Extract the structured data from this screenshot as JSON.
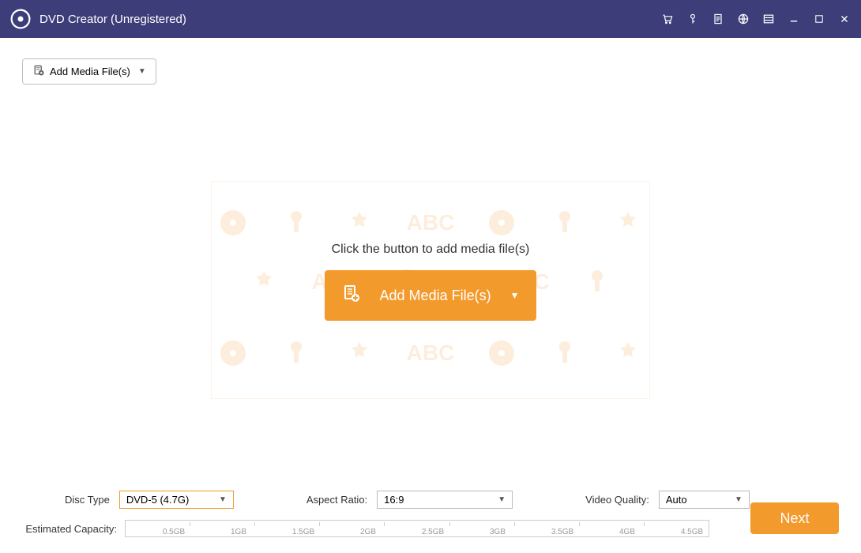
{
  "titlebar": {
    "app_title": "DVD Creator (Unregistered)"
  },
  "toolbar": {
    "add_media_label": "Add Media File(s)"
  },
  "main": {
    "instruction": "Click the button to add media file(s)",
    "add_media_label": "Add Media File(s)"
  },
  "controls": {
    "disc_type_label": "Disc Type",
    "disc_type_value": "DVD-5 (4.7G)",
    "aspect_ratio_label": "Aspect Ratio:",
    "aspect_ratio_value": "16:9",
    "video_quality_label": "Video Quality:",
    "video_quality_value": "Auto",
    "capacity_label": "Estimated Capacity:",
    "capacity_ticks": [
      "0.5GB",
      "1GB",
      "1.5GB",
      "2GB",
      "2.5GB",
      "3GB",
      "3.5GB",
      "4GB",
      "4.5GB"
    ],
    "next_label": "Next"
  },
  "colors": {
    "accent": "#f39a2d",
    "titlebar_bg": "#3d3d7a"
  }
}
